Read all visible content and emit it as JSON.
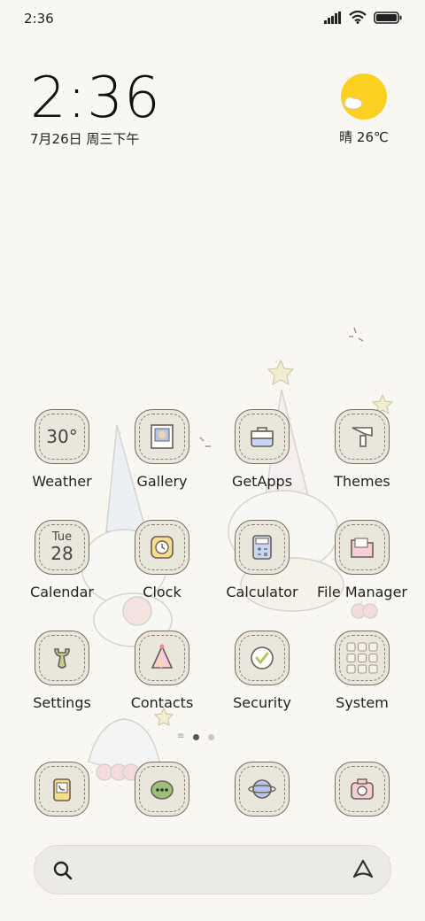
{
  "status_bar": {
    "time": "2:36"
  },
  "clock_widget": {
    "time": "2:36",
    "date": "7月26日 周三下午"
  },
  "weather_widget": {
    "condition_temp": "晴 26℃",
    "icon": "sun-cloud-icon"
  },
  "apps": [
    {
      "label": "Weather",
      "icon": "weather-icon",
      "icon_text": "30°"
    },
    {
      "label": "Gallery",
      "icon": "gallery-icon"
    },
    {
      "label": "GetApps",
      "icon": "getapps-icon"
    },
    {
      "label": "Themes",
      "icon": "themes-icon"
    },
    {
      "label": "Calendar",
      "icon": "calendar-icon",
      "icon_day": "Tue",
      "icon_date": "28"
    },
    {
      "label": "Clock",
      "icon": "clock-icon"
    },
    {
      "label": "Calculator",
      "icon": "calculator-icon"
    },
    {
      "label": "File Manager",
      "icon": "file-manager-icon"
    },
    {
      "label": "Settings",
      "icon": "settings-icon"
    },
    {
      "label": "Contacts",
      "icon": "contacts-icon"
    },
    {
      "label": "Security",
      "icon": "security-icon"
    },
    {
      "label": "System",
      "icon": "system-folder-icon"
    }
  ],
  "page_indicator": {
    "pages": 2,
    "active": 1
  },
  "dock": [
    {
      "icon": "phone-icon"
    },
    {
      "icon": "messages-icon"
    },
    {
      "icon": "browser-icon"
    },
    {
      "icon": "camera-icon"
    }
  ],
  "search_bar": {
    "left_icon": "search-icon",
    "right_icon": "assistant-icon"
  },
  "colors": {
    "sun": "#fcd021",
    "icon_bg": "#e9e6dc",
    "icon_border": "#7a6a62",
    "background": "#f8f7f2"
  }
}
